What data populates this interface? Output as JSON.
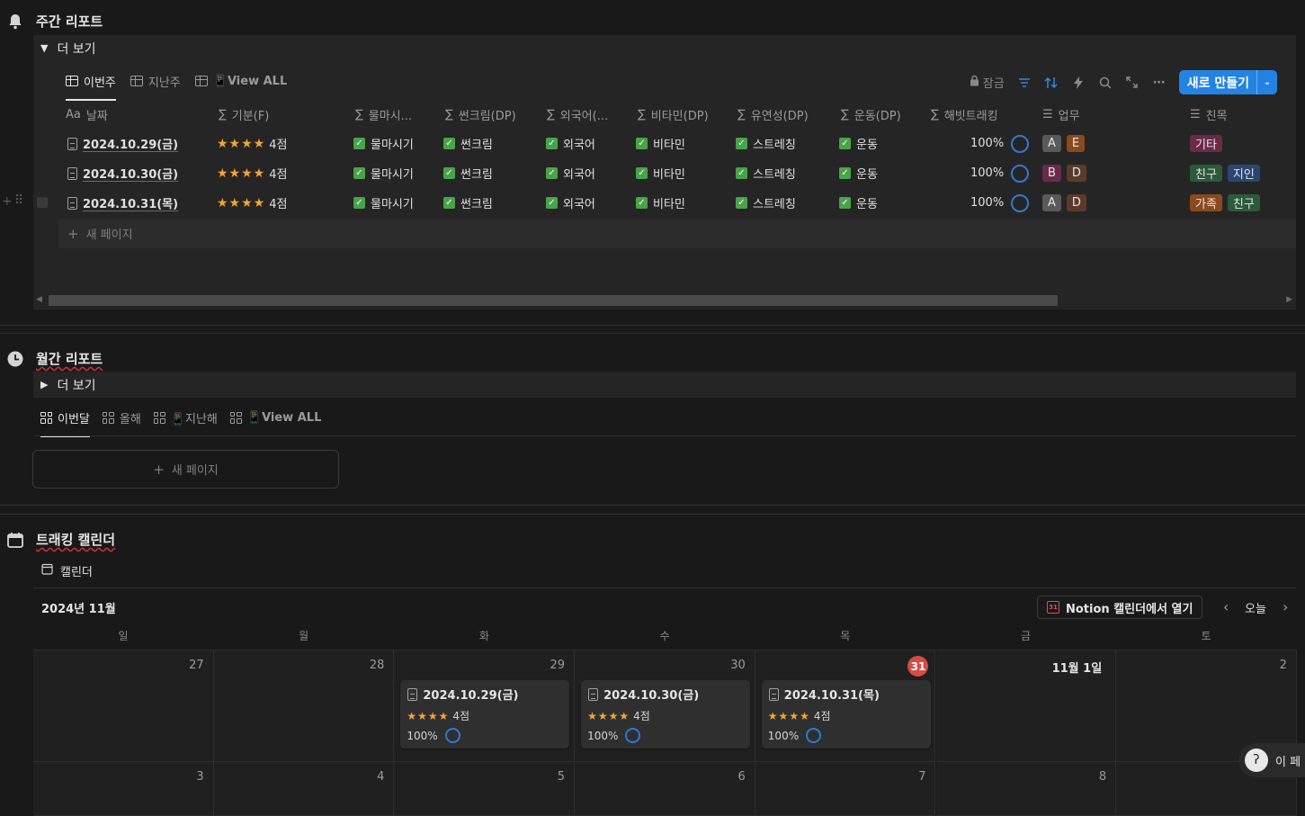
{
  "weekly": {
    "title": "주간 리포트",
    "toggle_label": "더 보기",
    "tabs": [
      "이번주",
      "지난주",
      "📱View ALL"
    ],
    "lock_label": "잠금",
    "new_button": "새로 만들기",
    "columns": [
      "날짜",
      "기분(F)",
      "물마시...",
      "썬크림(DP)",
      "외국어(...",
      "비타민(DP)",
      "유연성(DP)",
      "운동(DP)",
      "해빗트래킹",
      "업무",
      "친목"
    ],
    "col_prefix": {
      "date": "Aa",
      "sigma": "∑",
      "list": "☰"
    },
    "rows": [
      {
        "date": "2024.10.29(금)",
        "stars": "★★★★",
        "mood": "4점",
        "water": "물마시기",
        "sun": "썬크림",
        "lang": "외국어",
        "vit": "비타민",
        "flex": "스트레칭",
        "ex": "운동",
        "habit": "100%",
        "work": [
          {
            "t": "A",
            "c": "#5a5a5a"
          },
          {
            "t": "E",
            "c": "#8a4a1e"
          }
        ],
        "social": [
          {
            "t": "기타",
            "c": "#6b2a4a"
          }
        ]
      },
      {
        "date": "2024.10.30(금)",
        "stars": "★★★★",
        "mood": "4점",
        "water": "물마시기",
        "sun": "썬크림",
        "lang": "외국어",
        "vit": "비타민",
        "flex": "스트레칭",
        "ex": "운동",
        "habit": "100%",
        "work": [
          {
            "t": "B",
            "c": "#6b2a4a"
          },
          {
            "t": "D",
            "c": "#5c3a2a"
          }
        ],
        "social": [
          {
            "t": "친구",
            "c": "#2b5a3a"
          },
          {
            "t": "지인",
            "c": "#2a4670"
          }
        ]
      },
      {
        "date": "2024.10.31(목)",
        "stars": "★★★★",
        "mood": "4점",
        "water": "물마시기",
        "sun": "썬크림",
        "lang": "외국어",
        "vit": "비타민",
        "flex": "스트레칭",
        "ex": "운동",
        "habit": "100%",
        "work": [
          {
            "t": "A",
            "c": "#5a5a5a"
          },
          {
            "t": "D",
            "c": "#5c3a2a"
          }
        ],
        "social": [
          {
            "t": "가족",
            "c": "#8a4a1e"
          },
          {
            "t": "친구",
            "c": "#2b5a3a"
          }
        ]
      }
    ],
    "new_page": "새 페이지"
  },
  "monthly": {
    "title": "월간 리포트",
    "toggle_label": "더 보기",
    "tabs": [
      "이번달",
      "올해",
      "📱지난해",
      "📱View ALL"
    ],
    "new_page": "새 페이지"
  },
  "calendar": {
    "title": "트래킹 캘린더",
    "view_label": "캘린더",
    "month": "2024년 11월",
    "open_button": "Notion 캘린더에서 열기",
    "today": "오늘",
    "weekdays": [
      "일",
      "월",
      "화",
      "수",
      "목",
      "금",
      "토"
    ],
    "week1": [
      "27",
      "28",
      "29",
      "30",
      "31",
      "11월 1일",
      "2"
    ],
    "week2": [
      "3",
      "4",
      "5",
      "6",
      "7",
      "8",
      ""
    ],
    "today_badge": "31",
    "cards": [
      {
        "title": "2024.10.29(금)",
        "stars": "★★★★",
        "mood": "4점",
        "habit": "100%"
      },
      {
        "title": "2024.10.30(금)",
        "stars": "★★★★",
        "mood": "4점",
        "habit": "100%"
      },
      {
        "title": "2024.10.31(목)",
        "stars": "★★★★",
        "mood": "4점",
        "habit": "100%"
      }
    ]
  },
  "floating": {
    "label": "이 페"
  }
}
